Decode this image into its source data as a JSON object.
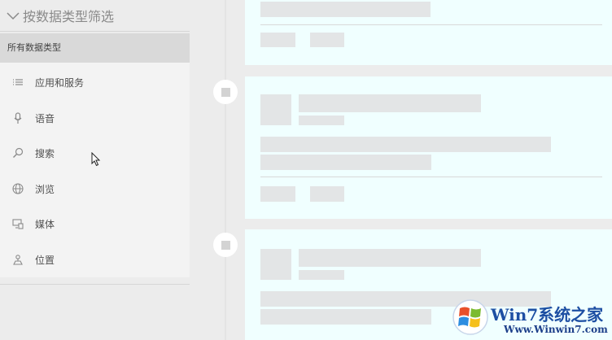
{
  "filter": {
    "header": "按数据类型筛选",
    "icon": "chevron-down-icon"
  },
  "panel": {
    "title": "所有数据类型",
    "items": [
      {
        "label": "应用和服务",
        "icon": "list-icon"
      },
      {
        "label": "语音",
        "icon": "microphone-icon"
      },
      {
        "label": "搜索",
        "icon": "search-icon"
      },
      {
        "label": "浏览",
        "icon": "globe-icon"
      },
      {
        "label": "媒体",
        "icon": "media-icon"
      },
      {
        "label": "位置",
        "icon": "location-icon"
      }
    ]
  },
  "watermark": {
    "brand": "Win7系统之家",
    "site": "Www.Winwin7.com"
  },
  "colors": {
    "card_background": "#f0ffff",
    "placeholder": "#e3e5e6",
    "brand_blue": "#1d4fa3"
  }
}
